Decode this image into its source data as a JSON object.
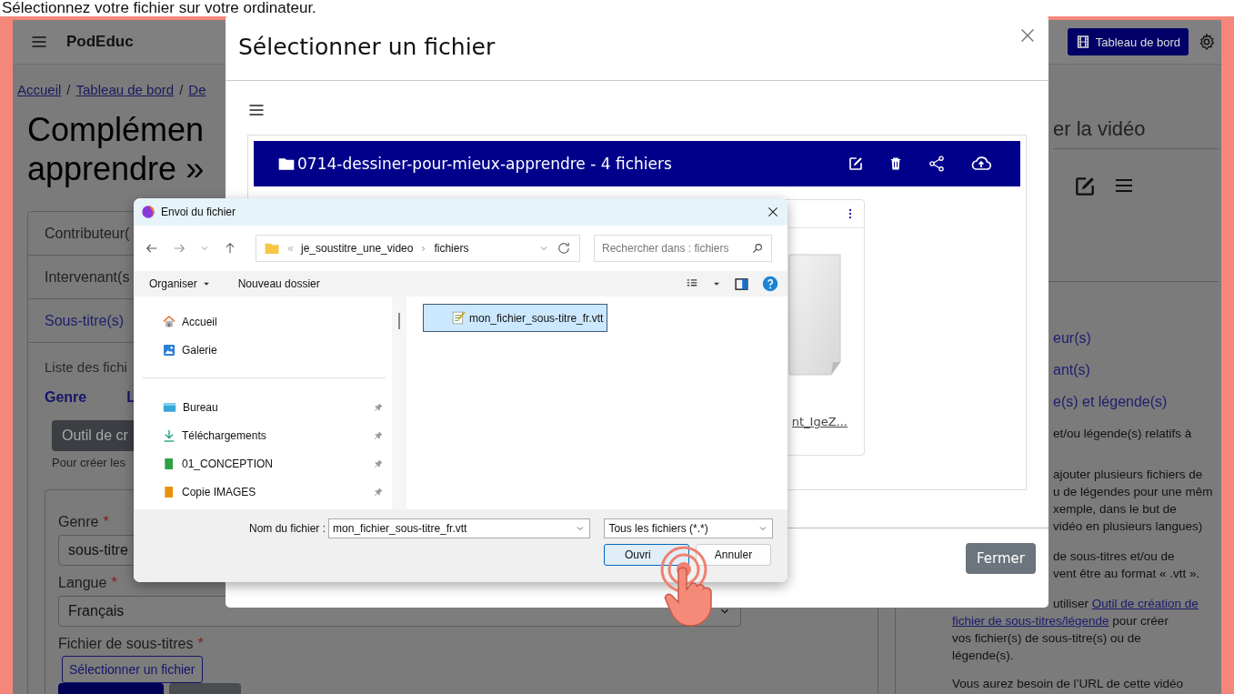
{
  "caption": "Sélectionnez votre fichier sur votre ordinateur.",
  "navbar": {
    "brand": "PodEduc",
    "dashboard_button": "Tableau de bord"
  },
  "breadcrumb": {
    "links": [
      "Accueil",
      "Tableau de bord",
      "De"
    ],
    "separators": [
      "/",
      "/"
    ]
  },
  "page_title": [
    "Complémen",
    "apprendre »"
  ],
  "accordion": [
    {
      "label": "Contributeur(",
      "expanded": false
    },
    {
      "label": "Intervenant(s",
      "expanded": false
    },
    {
      "label": "Sous-titre(s)",
      "expanded": true
    }
  ],
  "subtitles": {
    "list_label": "Liste des fichi",
    "columns": [
      "Genre",
      "L"
    ],
    "tool_button": "Outil de cr",
    "tool_hint": "Pour créer les",
    "fields": [
      {
        "label": "Genre",
        "required_mark": "*",
        "value": "sous-titre"
      },
      {
        "label": "Langue",
        "required_mark": "*",
        "value": "Français"
      }
    ],
    "file_field": {
      "label": "Fichier de sous-titres",
      "required_mark": "*",
      "button": "Sélectionner un fichier"
    }
  },
  "sidebar": {
    "heading": "er la vidéo",
    "links": [
      "eur(s)",
      "ant(s)",
      "e(s) et légende(s)"
    ],
    "paragraphs": [
      [
        [
          {
            "kind": "text",
            "text": "et/ou légende(s) relatifs à"
          }
        ]
      ],
      [
        [
          {
            "kind": "text",
            "text": "ajouter plusieurs fichiers de"
          }
        ],
        [
          {
            "kind": "text",
            "text": "u de légendes pour une mêm"
          }
        ],
        [
          {
            "kind": "text",
            "text": "xemple, dans le but de"
          }
        ],
        [
          {
            "kind": "text",
            "text": "vidéo en plusieurs langues)"
          }
        ]
      ],
      [
        [
          {
            "kind": "text",
            "text": "de sous-titres et/ou de"
          }
        ],
        [
          {
            "kind": "text",
            "text": "vent être au format « .vtt »."
          }
        ]
      ],
      [
        [
          {
            "kind": "text",
            "text": "utiliser "
          },
          {
            "kind": "link",
            "text": "Outil de création de"
          }
        ],
        [
          {
            "kind": "link",
            "text": "fichier de sous-titres/légende"
          },
          {
            "kind": "text",
            "text": " pour créer"
          }
        ],
        [
          {
            "kind": "text",
            "text": "vos fichier(s) de sous-titre(s) ou de"
          }
        ],
        [
          {
            "kind": "text",
            "text": "légende(s)."
          }
        ]
      ],
      [
        [
          {
            "kind": "text",
            "text": "Vous aurez besoin de l’URL de cette vidéo"
          }
        ]
      ]
    ]
  },
  "modal": {
    "title": "Sélectionner un fichier",
    "folder": "0714-dessiner-pour-mieux-apprendre - 4 fichiers",
    "file_card": {
      "name": "nt_IgeZ..."
    },
    "close_button": "Fermer"
  },
  "file_dialog": {
    "title": "Envoi du fichier",
    "path": [
      "je_soustitre_une_video",
      "fichiers"
    ],
    "search_placeholder": "Rechercher dans : fichiers",
    "toolbar": [
      "Organiser",
      "Nouveau dossier"
    ],
    "nav_groups": [
      [
        {
          "kind": "home",
          "label": "Accueil",
          "pinned": false
        },
        {
          "kind": "gallery",
          "label": "Galerie",
          "pinned": false
        }
      ],
      [
        {
          "kind": "desktop",
          "label": "Bureau",
          "pinned": true
        },
        {
          "kind": "download",
          "label": "Téléchargements",
          "pinned": true
        },
        {
          "kind": "folder",
          "label": "01_CONCEPTION",
          "pinned": true,
          "color": "#2ea043"
        },
        {
          "kind": "folder",
          "label": "Copie IMAGES",
          "pinned": true,
          "color": "#e8920c"
        }
      ]
    ],
    "files": [
      {
        "name": "mon_fichier_sous-titre_fr.vtt",
        "selected": true
      }
    ],
    "filename_label": "Nom du fichier :",
    "filename_value": "mon_fichier_sous-titre_fr.vtt",
    "filter": "Tous les fichiers (*.*)",
    "buttons": [
      {
        "label": "Ouvri",
        "default": true
      },
      {
        "label": "Annuler",
        "default": false
      }
    ]
  }
}
